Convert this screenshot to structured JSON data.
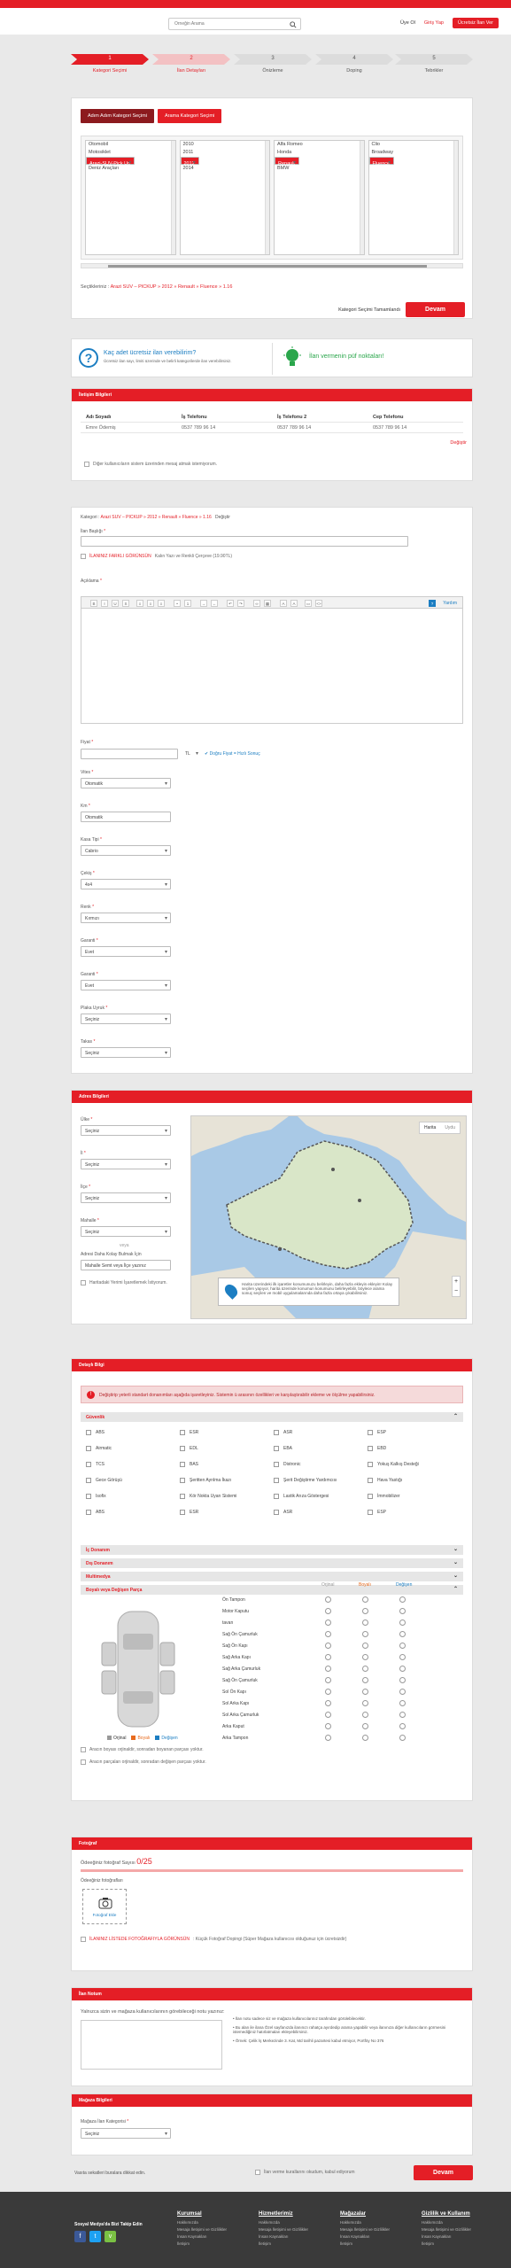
{
  "header": {
    "search_placeholder": "Örneğin Arama",
    "login": "Üye Ol",
    "register": "Giriş Yap",
    "free_post": "Ücretsiz İlan Ver"
  },
  "steps": [
    {
      "num": "1",
      "label": "Kategori Seçimi"
    },
    {
      "num": "2",
      "label": "İlan Detayları"
    },
    {
      "num": "3",
      "label": "Önizleme"
    },
    {
      "num": "4",
      "label": "Doping"
    },
    {
      "num": "5",
      "label": "Tebrikler"
    }
  ],
  "category": {
    "btn_step": "Adım Adım Kategori Seçimi",
    "btn_search": "Arama Kategori Seçimi",
    "col1": [
      "Otomobil",
      "Motosiklet",
      "Arazi-SUV-Pick Up",
      "Ticari Araçlar",
      "Deniz Araçları"
    ],
    "col2": [
      "2010",
      "2011",
      "2012",
      "2013",
      "2014"
    ],
    "col3": [
      "Alfa Romeo",
      "Honda",
      "Renault",
      "Bugatti",
      "BMW"
    ],
    "col4": [
      "Clio",
      "Broadway",
      "Fluence",
      "Megane"
    ],
    "selected_prefix": "Seçtikleriniz : ",
    "selected_path": "Arazi SUV – PICKUP » 2012 » Renault » Fluence » 1.16",
    "finish_text": "Kategori Seçimi Tamamlandı",
    "continue": "Devam"
  },
  "info": {
    "question": "Kaç adet ücretsiz ilan verebilirim?",
    "question_sub": "Ücretsiz ilan sayı, limiti üzerinde ve belirli kategorilerde ilan verebilirsiniz.",
    "tips": "İlan vermenin püf noktaları!"
  },
  "contact": {
    "title": "İletişim Bilgileri",
    "headers": [
      "Adı Soyadı",
      "İş Telefonu",
      "İş Telefonu 2",
      "Cep Telefonu"
    ],
    "row": [
      "Emre Ödemiş",
      "0537 789 96 14",
      "0537 789 96 14",
      "0537 789 96 14"
    ],
    "edit": "Değiştir",
    "hide": "Diğer kullanıcıların sistem üzerinden mesaj atmak istemiyorum."
  },
  "detail": {
    "category_label": "Kategori : ",
    "category_path": "Arazi SUV – PICKUP » 2012 » Renault » Fluence » 1.16",
    "category_change": "Değiştir",
    "title_label": "İlan Başlığı",
    "title_value": "",
    "highlight": "İLANINIZ FARKLI GÖRÜNSÜN",
    "highlight_sub": "Kalın Yazı ve Renkli Çerçeve (19.90TL)",
    "desc_label": "Açıklama",
    "help": "Yardım",
    "price_label": "Fiyat",
    "currency": "TL",
    "price_hint": "Doğru Fiyat = Hızlı Sonuç",
    "fields": [
      {
        "label": "Vites",
        "value": "Otomatik"
      },
      {
        "label": "Km",
        "value": "Otomatik"
      },
      {
        "label": "Kasa Tipi",
        "value": "Cabrio"
      },
      {
        "label": "Çekiş",
        "value": "4x4"
      },
      {
        "label": "Renk",
        "value": "Kırmızı"
      },
      {
        "label": "Garanti",
        "value": "Evet"
      },
      {
        "label": "Garanti",
        "value": "Evet"
      },
      {
        "label": "Plaka Uyruk",
        "value": "Seçiniz"
      },
      {
        "label": "Takas",
        "value": "Seçiniz"
      }
    ]
  },
  "address": {
    "title": "Adres Bilgileri",
    "fields": [
      {
        "label": "Ülke",
        "value": "Seçiniz"
      },
      {
        "label": "İl",
        "value": "Seçiniz"
      },
      {
        "label": "İlçe",
        "value": "Seçiniz"
      },
      {
        "label": "Mahalle",
        "value": "Seçiniz"
      }
    ],
    "or": "veya",
    "easy_label": "Adresi Daha Kolay Bulmak İçin",
    "easy_placeholder": "Mahalle Semt veya İlçe yazınız",
    "map_check": "Haritadaki Yerimi İşaretlemek İstiyorum.",
    "map_btn1": "Harita",
    "map_btn2": "Uydu",
    "map_note": "Harita üzerindeki ilk işaretler konumunuzu belirleyin, daha fazla ekleyin ekleyin! Kolay seçilen yapıyor, harita üzerinde konumun konumunu belirleyebilir, böylece arama sonuç seçilen ve mobil uygulamalarında daha fazla ortaya çıkabilirsiniz.",
    "zoom_in": "+",
    "zoom_out": "−"
  },
  "features": {
    "title": "Detaylı Bilgi",
    "alert": "Değiştirip yeterli standart donanımları aşağıda işaretleyiniz. Sistemin ü arasının özellikleri ve karşılaştırabilir ekleme ve ölçülme yapabilirsiniz.",
    "sec1": "Güvenlik",
    "items": [
      [
        "ABS",
        "ESR",
        "ASR",
        "ESP"
      ],
      [
        "Airmatic",
        "EDL",
        "EBA",
        "EBD"
      ],
      [
        "TCS",
        "BAS",
        "Distronic",
        "Yokuş Kalkış Desteği"
      ],
      [
        "Gece Görüşü",
        "Şeritten Ayrılma İkazı",
        "Şerit Değiştirme Yardımcısı",
        "Hava Yastığı"
      ],
      [
        "Isofix",
        "Kör Nokta Uyarı Sistemi",
        "Lastik Arıza Göstergesi",
        "İmmobilizer"
      ],
      [
        "ABS",
        "ESR",
        "ASR",
        "ESP"
      ]
    ],
    "sec2": "İç Donanım",
    "sec3": "Dış Donanım",
    "sec4": "Multimedya",
    "sec5": "Boyalı veya Değişen Parça",
    "part_headers": [
      "Orjinal",
      "Boyalı",
      "Değişen"
    ],
    "parts": [
      "Ön Tampon",
      "Motor Kaputu",
      "tavan",
      "Sağ Ön Çamurluk",
      "Sağ Ön Kapı",
      "Sağ Arka Kapı",
      "Sağ Arka Çamurluk",
      "Sağ Ön Çamurluk",
      "Sol Ön Kapı",
      "Sol Arka Kapı",
      "Sol Arka Çamurluk",
      "Arka Kaput",
      "Arka Tampon"
    ],
    "legend": [
      "Orjinal",
      "Boyalı",
      "Değişen"
    ],
    "check1": "Aracın boyası orjinaldir, sonradan boyanan parçası yoktur.",
    "check2": "Aracın parçaları orjinaldir, sonradan değişen parçası yoktur."
  },
  "photos": {
    "title": "Fotoğraf",
    "count_label": "Ödeeğiniz fotoğraf Sayısı ",
    "count": "0/25",
    "list_label": "Ödeeğiniz fotoğrafları",
    "upload": "Fotoğraf Ekle",
    "highlight": "İLANINIZ LİSTEDE FOTOĞRAFIYLA GÖRÜNSÜN",
    "highlight_sub": ": Küçük Fotoğraf Dopingi (Süper Mağaza kullanıcısı olduğunuz için ücretsizdir)"
  },
  "note": {
    "title": "İlan Notum",
    "label": "Yalnızca sizin ve mağaza kullanıcılarının görebileceği notu yazınız:",
    "n1": "İlan notu sadece siz ve mağaza kullanıcılarınız tarafından görülebilecektir.",
    "n2": "Bu alan ile ilana Özel sayfanızda ilanınızı rahatça ayırdedip arama yapabilir veya ilanınıza diğer kullanıcıların görmesini istemediğiniz hatırlatmaları ekleyebilirsiniz.",
    "n3": "Örnek: Çelik İş Merkezinde 3. Kat, Md tarihli pazartesi kabul etmiyor, Portföy No 376"
  },
  "store": {
    "title": "Mağaza Bilgileri",
    "label": "Mağaza İlan Kategorisi",
    "value": "Seçiniz"
  },
  "bottom": {
    "left": "Vasıta sekatleri buralara dikkat edin.",
    "agree": "İlan verme kurallarını okudum, kabul ediyorum",
    "continue": "Devam"
  },
  "footer": {
    "follow": "Sosyal Medya'da Bizi Takip Edin",
    "cols": [
      {
        "h": "Kurumsal",
        "items": [
          "Hakkımızda",
          "Mesaja İletişimi ve Gizlilikler",
          "İnsan Kaynakları",
          "İletişim"
        ]
      },
      {
        "h": "Hizmetlerimiz",
        "items": [
          "Hakkımızda",
          "Mesaja İletişimi ve Gizlilikler",
          "İnsan Kaynakları",
          "İletişim"
        ]
      },
      {
        "h": "Mağazalar",
        "items": [
          "Hakkımızda",
          "Mesaja İletişimi ve Gizlilikler",
          "İnsan Kaynakları",
          "İletişim"
        ]
      },
      {
        "h": "Gizlilik ve Kullanım",
        "items": [
          "Hakkımızda",
          "Mesaja İletişimi ve Gizlilikler",
          "İnsan Kaynakları",
          "İletişim"
        ]
      }
    ],
    "social": [
      "f",
      "t",
      "v"
    ]
  },
  "colors": {
    "brand": "#e41e26",
    "info": "#1c7ec2",
    "success": "#2aa64b"
  }
}
